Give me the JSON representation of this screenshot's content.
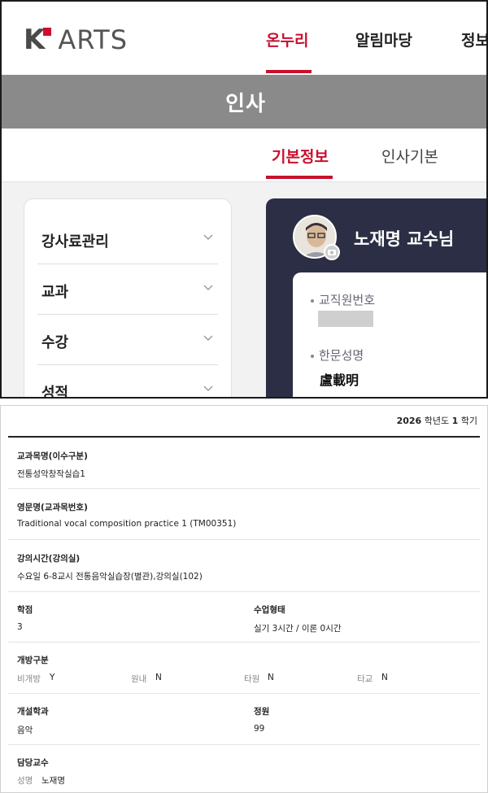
{
  "brand": {
    "logo_letter": "K",
    "logo_word": "ARTS",
    "accent_color": "#c8102e"
  },
  "nav": {
    "items": [
      {
        "label": "온누리",
        "active": true
      },
      {
        "label": "알림마당",
        "active": false
      },
      {
        "label": "정보",
        "active": false
      }
    ]
  },
  "page_title": "인사",
  "subtabs": [
    {
      "label": "기본정보",
      "active": true
    },
    {
      "label": "인사기본",
      "active": false
    }
  ],
  "sidebar": {
    "items": [
      {
        "label": "강사료관리",
        "icon": "chevron-down-icon"
      },
      {
        "label": "교과",
        "icon": "chevron-down-icon"
      },
      {
        "label": "수강",
        "icon": "chevron-down-icon"
      },
      {
        "label": "성적",
        "icon": "chevron-down-icon"
      }
    ]
  },
  "profile": {
    "name": "노재명 교수님",
    "avatar_icon": "user-avatar",
    "camera_icon": "camera-icon",
    "fields": [
      {
        "label": "교직원번호",
        "value": ""
      },
      {
        "label": "한문성명",
        "value": "盧載明"
      }
    ]
  },
  "course": {
    "year": "2026",
    "year_suffix": "학년도",
    "semester": "1",
    "semester_suffix": "학기",
    "course_name_label": "교과목명(이수구분)",
    "course_name": "전통성악창작실습1",
    "english_name_label": "영문명(교과목번호)",
    "english_name": "Traditional vocal composition practice 1 (TM00351)",
    "schedule_label": "강의시간(강의실)",
    "schedule": "수요일 6-8교시 전통음악실습장(별관),강의실(102)",
    "credits_label": "학점",
    "credits": "3",
    "class_type_label": "수업형태",
    "class_type": "실기 3시간 / 이론 0시간",
    "open_label": "개방구분",
    "open_options": [
      {
        "label": "비개방",
        "value": "Y"
      },
      {
        "label": "원내",
        "value": "N"
      },
      {
        "label": "타원",
        "value": "N"
      },
      {
        "label": "타교",
        "value": "N"
      }
    ],
    "dept_label": "개설학과",
    "dept": "음악",
    "capacity_label": "정원",
    "capacity": "99",
    "professor_label": "담당교수",
    "professor_name_label": "성명",
    "professor_name": "노재명"
  }
}
